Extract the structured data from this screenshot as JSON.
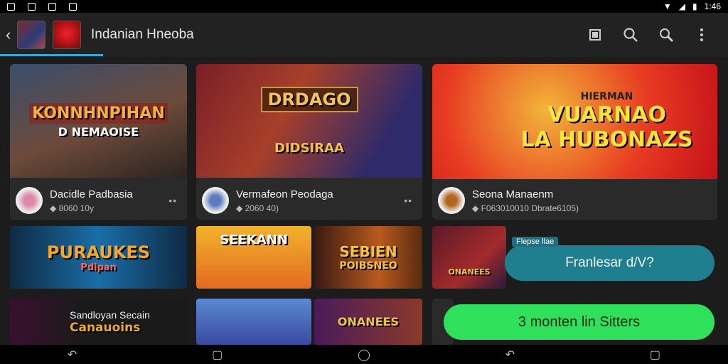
{
  "status": {
    "time": "1:46"
  },
  "appbar": {
    "title": "Indanian Hneoba",
    "icons": [
      "back-arrow",
      "bookmark-icon",
      "search-icon",
      "search-alt-icon",
      "more-icon"
    ]
  },
  "cards": [
    {
      "banner": "KONNHNPIHAN",
      "banner_sub": "D NEMAOISE",
      "name": "Dacidle Padbasia",
      "sub": "8060 10y"
    },
    {
      "banner": "DRDAGO",
      "banner_sub": "DIDSIRAA",
      "name": "Vermafeon Peodaga",
      "sub": "2060 40)"
    },
    {
      "banner": "VUARNAO",
      "banner_sub": "LA HUBONAZS",
      "banner_top": "HIERMAN",
      "name": "Seona Manaenm",
      "sub": "F063010010 Dbrate6105)"
    }
  ],
  "tiles": [
    {
      "text": "PURAUKES",
      "sub": "Pdipan"
    },
    {
      "text": "SEEKANN",
      "sub": ""
    },
    {
      "text": "SEBIEN",
      "sub": "POIBSNEO"
    },
    {
      "text": "Sandloyan Secain",
      "sub": "Canauoins"
    },
    {
      "text": "",
      "sub": ""
    },
    {
      "text": "ONANEES",
      "sub": ""
    }
  ],
  "toast": {
    "label": "Flepse llae",
    "text": "Franlesar d/V?"
  },
  "cta": {
    "text": "3 monten lin Sitters"
  },
  "colors": {
    "accent": "#39a7d4",
    "cta": "#2fe05a",
    "toast": "#1f7f8f"
  }
}
